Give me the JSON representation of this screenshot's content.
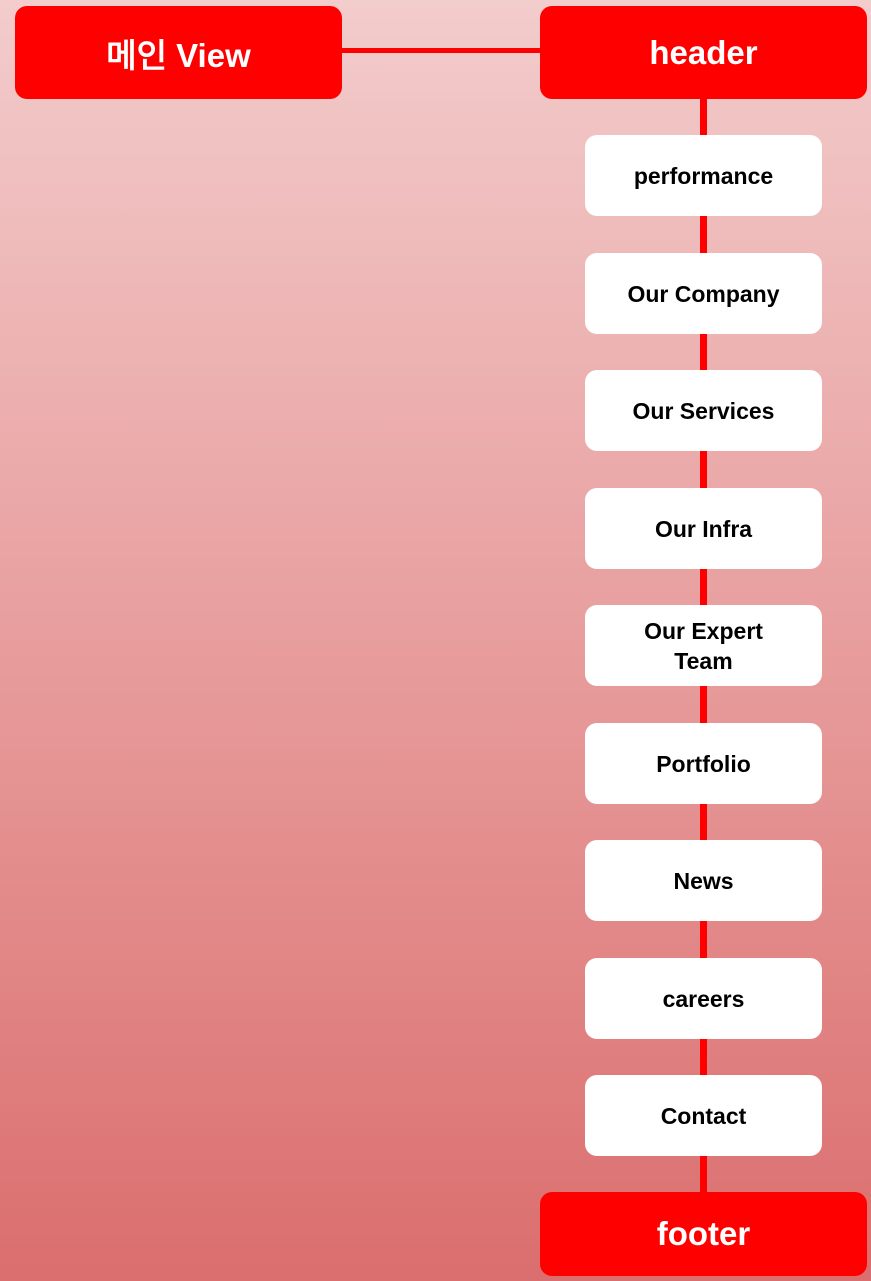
{
  "main_view": {
    "label": "메인 View"
  },
  "header": {
    "label": "header"
  },
  "footer": {
    "label": "footer"
  },
  "sections": [
    {
      "label": "performance"
    },
    {
      "label": "Our Company"
    },
    {
      "label": "Our Services"
    },
    {
      "label": "Our Infra"
    },
    {
      "label": "Our Expert Team"
    },
    {
      "label": "Portfolio"
    },
    {
      "label": "News"
    },
    {
      "label": "careers"
    },
    {
      "label": "Contact"
    }
  ],
  "colors": {
    "accent": "#ff0000",
    "node_background": "#ffffff",
    "text_on_accent": "#ffffff",
    "text_on_node": "#000000"
  }
}
